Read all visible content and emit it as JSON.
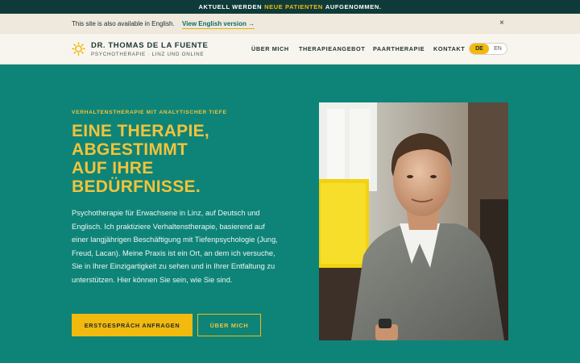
{
  "announcement": {
    "prefix": "AKTUELL WERDEN",
    "highlight": "NEUE PATIENTEN",
    "suffix": "AUFGENOMMEN."
  },
  "lang_notice": {
    "text": "This site is also available in English.",
    "link": "View English version →",
    "close": "×"
  },
  "header": {
    "name": "DR. THOMAS DE LA FUENTE",
    "subtitle": "PSYCHOTHERAPIE · LINZ UND ONLINE",
    "nav": [
      "ÜBER MICH",
      "THERAPIEANGEBOT",
      "PAARTHERAPIE",
      "KONTAKT"
    ],
    "lang": {
      "active": "DE",
      "other": "EN"
    }
  },
  "hero": {
    "eyebrow": "VERHALTENSTHERAPIE MIT ANALYTISCHER TIEFE",
    "headline": [
      "EINE THERAPIE,",
      "ABGESTIMMT",
      "AUF IHRE",
      "BEDÜRFNISSE."
    ],
    "body": "Psychotherapie für Erwachsene in Linz, auf Deutsch und Englisch. Ich praktiziere Verhaltenstherapie, basierend auf einer langjährigen Beschäftigung mit Tiefenpsychologie (Jung, Freud, Lacan). Meine Praxis ist ein Ort, an dem ich versuche, Sie in Ihrer Einzigartigkeit zu sehen und in Ihrer Entfaltung zu unterstützen. Hier können Sie sein, wie Sie sind.",
    "cta_primary": "ERSTGESPRÄCH ANFRAGEN",
    "cta_secondary": "ÜBER MICH"
  },
  "colors": {
    "accent": "#f2b90f",
    "hero_bg": "#0e8478",
    "topbar_bg": "#0e3b3a",
    "header_bg": "#f8f5ef"
  }
}
